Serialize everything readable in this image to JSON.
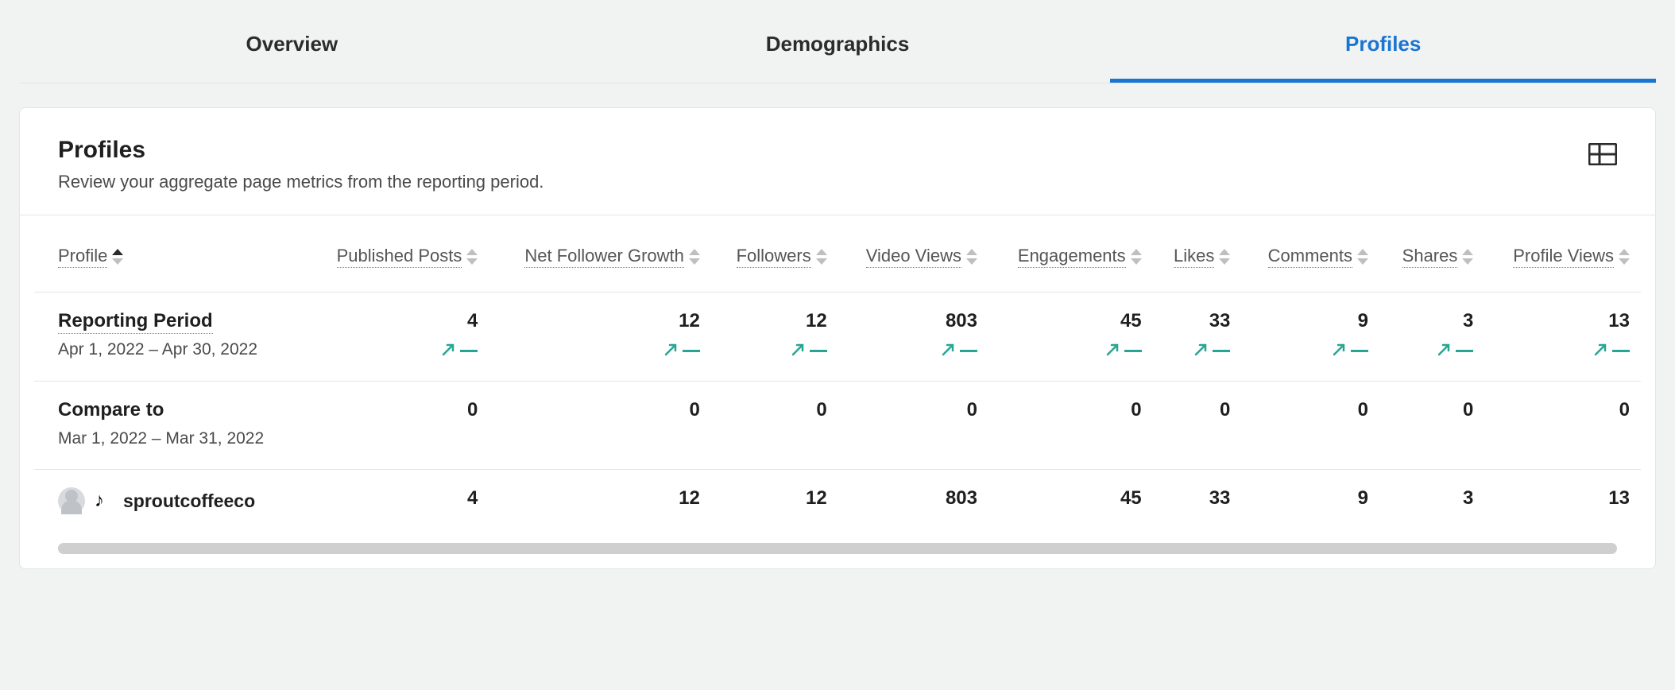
{
  "tabs": {
    "overview": "Overview",
    "demographics": "Demographics",
    "profiles": "Profiles",
    "active": "profiles"
  },
  "card": {
    "title": "Profiles",
    "subtitle": "Review your aggregate page metrics from the reporting period."
  },
  "columns": {
    "profile": "Profile",
    "published_posts": "Published Posts",
    "net_follower_growth": "Net Follower Growth",
    "followers": "Followers",
    "video_views": "Video Views",
    "engagements": "Engagements",
    "likes": "Likes",
    "comments": "Comments",
    "shares": "Shares",
    "profile_views": "Profile Views"
  },
  "rows": {
    "reporting": {
      "label": "Reporting Period",
      "range": "Apr 1, 2022 – Apr 30, 2022",
      "values": {
        "published_posts": "4",
        "net_follower_growth": "12",
        "followers": "12",
        "video_views": "803",
        "engagements": "45",
        "likes": "33",
        "comments": "9",
        "shares": "3",
        "profile_views": "13"
      }
    },
    "compare": {
      "label": "Compare to",
      "range": "Mar 1, 2022 – Mar 31, 2022",
      "values": {
        "published_posts": "0",
        "net_follower_growth": "0",
        "followers": "0",
        "video_views": "0",
        "engagements": "0",
        "likes": "0",
        "comments": "0",
        "shares": "0",
        "profile_views": "0"
      }
    },
    "profile": {
      "name": "sproutcoffeeco",
      "platform_icon": "tiktok",
      "values": {
        "published_posts": "4",
        "net_follower_growth": "12",
        "followers": "12",
        "video_views": "803",
        "engagements": "45",
        "likes": "33",
        "comments": "9",
        "shares": "3",
        "profile_views": "13"
      }
    }
  }
}
